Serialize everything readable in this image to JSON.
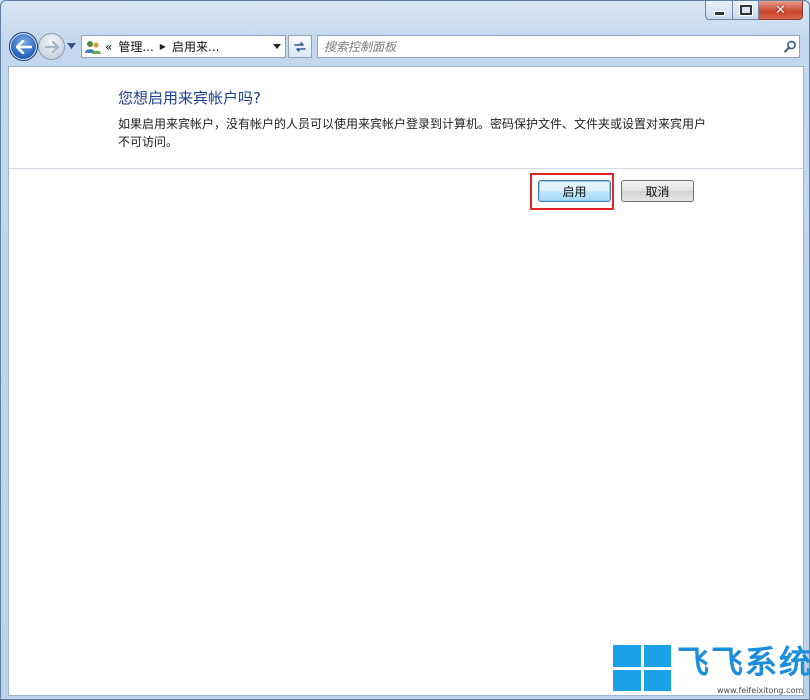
{
  "window": {
    "caption_buttons": {
      "minimize_icon": "minimize-icon",
      "maximize_icon": "maximize-icon",
      "close_icon": "close-icon",
      "close_glyph": "✕"
    }
  },
  "navigation": {
    "back_icon": "back-arrow-icon",
    "forward_icon": "forward-arrow-icon",
    "address": {
      "overflow_chevron": "«",
      "crumbs": [
        "管理...",
        "启用来..."
      ],
      "icon": "user-accounts-icon"
    },
    "search": {
      "placeholder": "搜索控制面板"
    }
  },
  "dialog": {
    "heading": "您想启用来宾帐户吗?",
    "description": "如果启用来宾帐户，没有帐户的人员可以使用来宾帐户登录到计算机。密码保护文件、文件夹或设置对来宾用户不可访问。",
    "buttons": {
      "enable": "启用",
      "cancel": "取消"
    },
    "highlight_color": "#e02525"
  },
  "watermark": {
    "brand": "飞飞系统",
    "url": "www.feifeixitong.com",
    "logo_color": "#1aa1e8"
  }
}
